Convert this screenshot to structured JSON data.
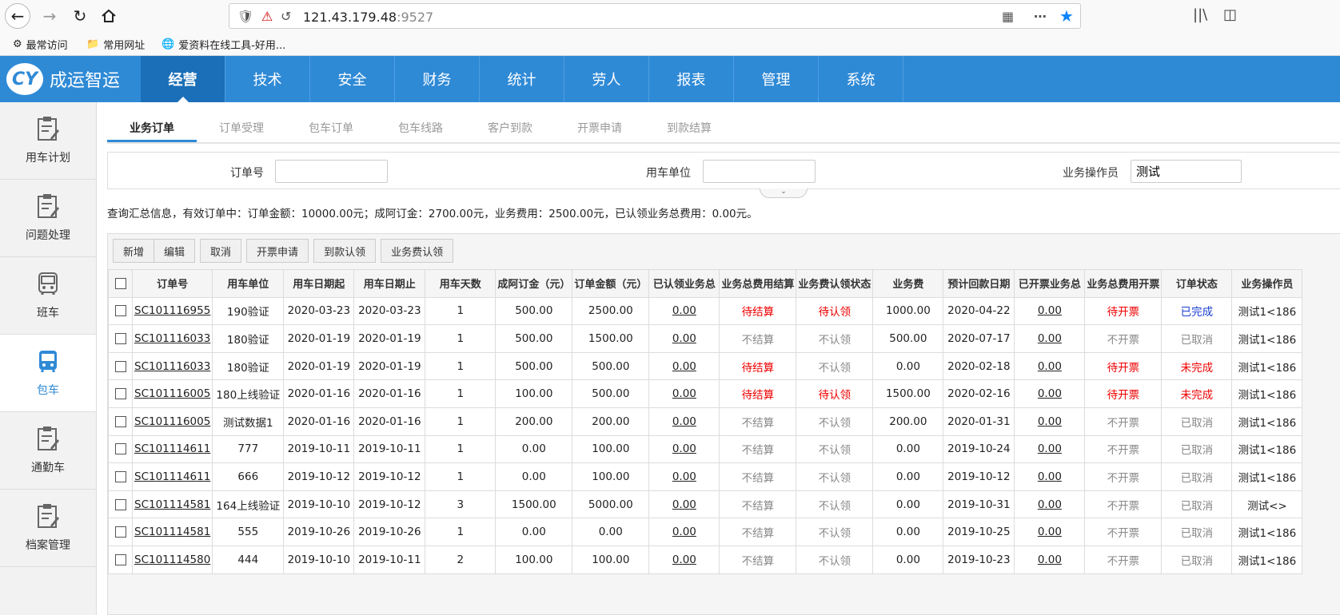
{
  "browser": {
    "url_host": "121.43.179.48",
    "url_port": ":9527",
    "bookmarks": [
      "最常访问",
      "常用网址",
      "爱资料在线工具-好用..."
    ]
  },
  "app": {
    "logo_text": "成运智运",
    "logo_mark": "CY",
    "top_nav": [
      "经营",
      "技术",
      "安全",
      "财务",
      "统计",
      "劳人",
      "报表",
      "管理",
      "系统"
    ],
    "top_nav_active": "经营",
    "accent_color": "#2f8ad6"
  },
  "sidebar": {
    "items": [
      {
        "label": "用车计划",
        "icon": "clipboard-icon"
      },
      {
        "label": "问题处理",
        "icon": "clipboard-icon"
      },
      {
        "label": "班车",
        "icon": "bus-icon"
      },
      {
        "label": "包车",
        "icon": "bus-icon",
        "active": true
      },
      {
        "label": "通勤车",
        "icon": "clipboard-icon"
      },
      {
        "label": "档案管理",
        "icon": "clipboard-icon"
      }
    ]
  },
  "subtabs": [
    "业务订单",
    "订单受理",
    "包车订单",
    "包车线路",
    "客户到款",
    "开票申请",
    "到款结算"
  ],
  "query": {
    "order_no_label": "订单号",
    "order_no_value": "",
    "unit_label": "用车单位",
    "unit_value": "",
    "operator_label": "业务操作员",
    "operator_value": "测试"
  },
  "summary": "查询汇总信息，有效订单中：订单金额：10000.00元；成阿订金：2700.00元，业务费用：2500.00元，已认领业务总费用：0.00元。",
  "toolbar": {
    "add": "新增",
    "edit": "编辑",
    "cancel": "取消",
    "invoice": "开票申请",
    "claim_payment": "到款认领",
    "claim_fee": "业务费认领"
  },
  "table": {
    "columns": [
      "订单号",
      "用车单位",
      "用车日期起",
      "用车日期止",
      "用车天数",
      "成阿订金（元）",
      "订单金额（元）",
      "已认领业务总",
      "业务总费用结算",
      "业务费认领状态",
      "业务费",
      "预计回款日期",
      "已开票业务总",
      "业务总费用开票",
      "订单状态",
      "业务操作员"
    ],
    "rows": [
      [
        "SC101116955",
        "190验证",
        "2020-03-23",
        "2020-03-23",
        "1",
        "500.00",
        "2500.00",
        "0.00",
        "待结算",
        "待认领",
        "1000.00",
        "2020-04-22",
        "0.00",
        "待开票",
        "已完成",
        "测试1<186"
      ],
      [
        "SC101116033",
        "180验证",
        "2020-01-19",
        "2020-01-19",
        "1",
        "500.00",
        "1500.00",
        "0.00",
        "不结算",
        "不认领",
        "500.00",
        "2020-07-17",
        "0.00",
        "不开票",
        "已取消",
        "测试1<186"
      ],
      [
        "SC101116033",
        "180验证",
        "2020-01-19",
        "2020-01-19",
        "1",
        "500.00",
        "500.00",
        "0.00",
        "待结算",
        "不认领",
        "0.00",
        "2020-02-18",
        "0.00",
        "待开票",
        "未完成",
        "测试1<186"
      ],
      [
        "SC101116005",
        "180上线验证",
        "2020-01-16",
        "2020-01-16",
        "1",
        "100.00",
        "500.00",
        "0.00",
        "待结算",
        "待认领",
        "1500.00",
        "2020-02-16",
        "0.00",
        "待开票",
        "未完成",
        "测试1<186"
      ],
      [
        "SC101116005",
        "测试数据1",
        "2020-01-16",
        "2020-01-16",
        "1",
        "200.00",
        "200.00",
        "0.00",
        "不结算",
        "不认领",
        "200.00",
        "2020-01-31",
        "0.00",
        "不开票",
        "已取消",
        "测试1<186"
      ],
      [
        "SC101114611",
        "777",
        "2019-10-11",
        "2019-10-11",
        "1",
        "0.00",
        "100.00",
        "0.00",
        "不结算",
        "不认领",
        "0.00",
        "2019-10-24",
        "0.00",
        "不开票",
        "已取消",
        "测试1<186"
      ],
      [
        "SC101114611",
        "666",
        "2019-10-12",
        "2019-10-12",
        "1",
        "0.00",
        "100.00",
        "0.00",
        "不结算",
        "不认领",
        "0.00",
        "2019-10-12",
        "0.00",
        "不开票",
        "已取消",
        "测试1<186"
      ],
      [
        "SC101114581",
        "164上线验证",
        "2019-10-10",
        "2019-10-12",
        "3",
        "1500.00",
        "5000.00",
        "0.00",
        "不结算",
        "不认领",
        "0.00",
        "2019-10-31",
        "0.00",
        "不开票",
        "已取消",
        "测试<>"
      ],
      [
        "SC101114581",
        "555",
        "2019-10-26",
        "2019-10-26",
        "1",
        "0.00",
        "0.00",
        "0.00",
        "不结算",
        "不认领",
        "0.00",
        "2019-10-25",
        "0.00",
        "不开票",
        "已取消",
        "测试1<186"
      ],
      [
        "SC101114580",
        "444",
        "2019-10-10",
        "2019-10-11",
        "2",
        "100.00",
        "100.00",
        "0.00",
        "不结算",
        "不认领",
        "0.00",
        "2019-10-23",
        "0.00",
        "不开票",
        "已取消",
        "测试1<186"
      ]
    ]
  }
}
